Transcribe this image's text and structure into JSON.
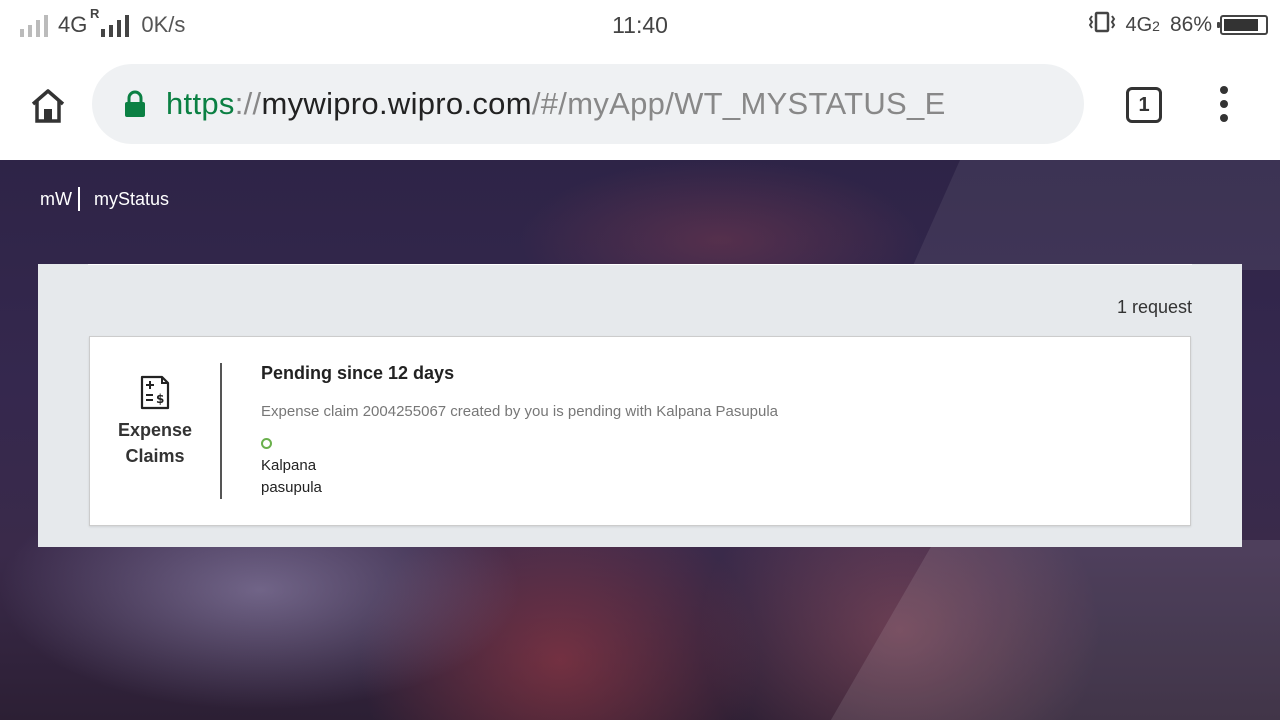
{
  "status_bar": {
    "network_type": "4G",
    "roaming": "R",
    "speed": "0K/s",
    "time": "11:40",
    "network2": "4G",
    "sim2": "2",
    "battery_percent": "86%",
    "battery_level": 0.86
  },
  "browser": {
    "url_scheme": "https",
    "url_sep": "://",
    "url_host": "mywipro.wipro.com",
    "url_path": "/#/myApp/WT_MYSTATUS_E",
    "tab_count": "1",
    "lock_color": "#0b8043"
  },
  "app": {
    "logo": "mW",
    "title": "myStatus"
  },
  "panel": {
    "request_count": "1 request"
  },
  "card": {
    "category_line1": "Expense",
    "category_line2": "Claims",
    "title": "Pending since 12 days",
    "description": "Expense claim 2004255067 created by you is pending with Kalpana Pasupula",
    "assignee_first": "Kalpana",
    "assignee_last": "pasupula",
    "status_color": "#6ab04c"
  }
}
